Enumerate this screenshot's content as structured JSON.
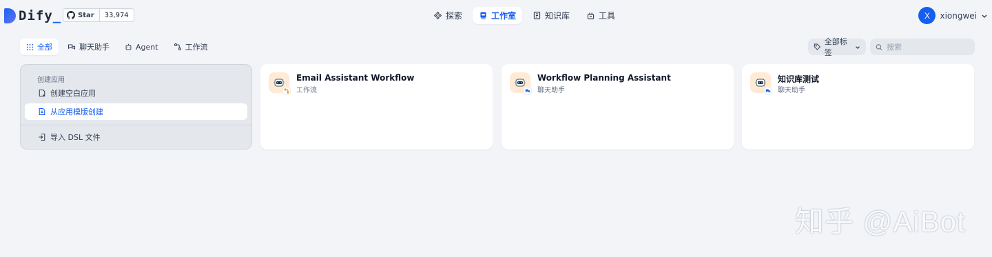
{
  "header": {
    "logo_text": "Dify",
    "logo_cursor": "_",
    "github": {
      "star_label": "Star",
      "star_count": "33,974"
    },
    "nav": [
      {
        "label": "探索",
        "icon": "explore-icon"
      },
      {
        "label": "工作室",
        "icon": "studio-icon",
        "active": true
      },
      {
        "label": "知识库",
        "icon": "knowledge-icon"
      },
      {
        "label": "工具",
        "icon": "tools-icon"
      }
    ],
    "user": {
      "avatar_initial": "X",
      "name": "xiongwei"
    }
  },
  "filters": {
    "tabs": [
      {
        "label": "全部",
        "icon": "grid-icon",
        "active": true
      },
      {
        "label": "聊天助手",
        "icon": "chat-icon"
      },
      {
        "label": "Agent",
        "icon": "agent-icon"
      },
      {
        "label": "工作流",
        "icon": "workflow-icon"
      }
    ],
    "tag_filter_label": "全部标签",
    "search_placeholder": "搜索"
  },
  "create_app": {
    "title": "创建应用",
    "blank_label": "创建空白应用",
    "template_label": "从应用模版创建",
    "import_label": "导入 DSL 文件"
  },
  "apps": [
    {
      "name": "Email Assistant Workflow",
      "type": "工作流",
      "badge": "workflow"
    },
    {
      "name": "Workflow Planning Assistant",
      "type": "聊天助手",
      "badge": "chat"
    },
    {
      "name": "知识库测试",
      "type": "聊天助手",
      "badge": "chat"
    }
  ],
  "colors": {
    "accent": "#155eef",
    "background": "#f2f4f7",
    "app_icon_bg": "#ffead5"
  },
  "watermark": "知乎 @AiBot"
}
